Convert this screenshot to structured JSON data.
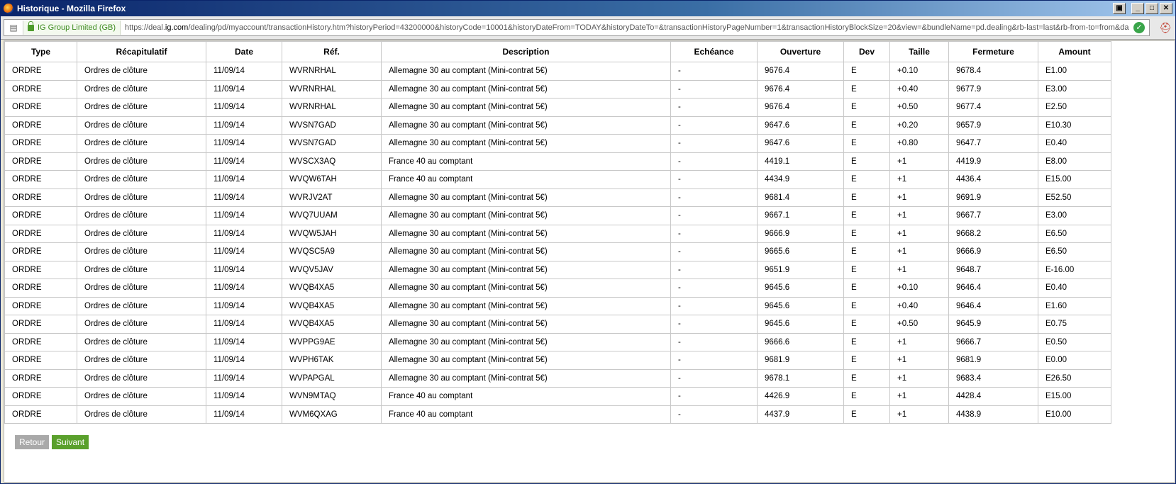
{
  "window": {
    "title": "Historique - Mozilla Firefox"
  },
  "navbar": {
    "identity": "IG Group Limited (GB)",
    "url_domain_prefix": "https://deal.",
    "url_domain_bold": "ig.com",
    "url_path": "/dealing/pd/myaccount/transactionHistory.htm?historyPeriod=43200000&historyCode=10001&historyDateFrom=TODAY&historyDateTo=&transactionHistoryPageNumber=1&transactionHistoryBlockSize=20&view=&bundleName=pd.dealing&rb-last=last&rb-from-to=from&da"
  },
  "table": {
    "headers": [
      "Type",
      "Récapitulatif",
      "Date",
      "Réf.",
      "Description",
      "Echéance",
      "Ouverture",
      "Dev",
      "Taille",
      "Fermeture",
      "Amount"
    ],
    "rows": [
      [
        "ORDRE",
        "Ordres de clôture",
        "11/09/14",
        "WVRNRHAL",
        "Allemagne 30 au comptant (Mini-contrat 5€)",
        "-",
        "9676.4",
        "E",
        "+0.10",
        "9678.4",
        "E1.00"
      ],
      [
        "ORDRE",
        "Ordres de clôture",
        "11/09/14",
        "WVRNRHAL",
        "Allemagne 30 au comptant (Mini-contrat 5€)",
        "-",
        "9676.4",
        "E",
        "+0.40",
        "9677.9",
        "E3.00"
      ],
      [
        "ORDRE",
        "Ordres de clôture",
        "11/09/14",
        "WVRNRHAL",
        "Allemagne 30 au comptant (Mini-contrat 5€)",
        "-",
        "9676.4",
        "E",
        "+0.50",
        "9677.4",
        "E2.50"
      ],
      [
        "ORDRE",
        "Ordres de clôture",
        "11/09/14",
        "WVSN7GAD",
        "Allemagne 30 au comptant (Mini-contrat 5€)",
        "-",
        "9647.6",
        "E",
        "+0.20",
        "9657.9",
        "E10.30"
      ],
      [
        "ORDRE",
        "Ordres de clôture",
        "11/09/14",
        "WVSN7GAD",
        "Allemagne 30 au comptant (Mini-contrat 5€)",
        "-",
        "9647.6",
        "E",
        "+0.80",
        "9647.7",
        "E0.40"
      ],
      [
        "ORDRE",
        "Ordres de clôture",
        "11/09/14",
        "WVSCX3AQ",
        "France 40 au comptant",
        "-",
        "4419.1",
        "E",
        "+1",
        "4419.9",
        "E8.00"
      ],
      [
        "ORDRE",
        "Ordres de clôture",
        "11/09/14",
        "WVQW6TAH",
        "France 40 au comptant",
        "-",
        "4434.9",
        "E",
        "+1",
        "4436.4",
        "E15.00"
      ],
      [
        "ORDRE",
        "Ordres de clôture",
        "11/09/14",
        "WVRJV2AT",
        "Allemagne 30 au comptant (Mini-contrat 5€)",
        "-",
        "9681.4",
        "E",
        "+1",
        "9691.9",
        "E52.50"
      ],
      [
        "ORDRE",
        "Ordres de clôture",
        "11/09/14",
        "WVQ7UUAM",
        "Allemagne 30 au comptant (Mini-contrat 5€)",
        "-",
        "9667.1",
        "E",
        "+1",
        "9667.7",
        "E3.00"
      ],
      [
        "ORDRE",
        "Ordres de clôture",
        "11/09/14",
        "WVQW5JAH",
        "Allemagne 30 au comptant (Mini-contrat 5€)",
        "-",
        "9666.9",
        "E",
        "+1",
        "9668.2",
        "E6.50"
      ],
      [
        "ORDRE",
        "Ordres de clôture",
        "11/09/14",
        "WVQSC5A9",
        "Allemagne 30 au comptant (Mini-contrat 5€)",
        "-",
        "9665.6",
        "E",
        "+1",
        "9666.9",
        "E6.50"
      ],
      [
        "ORDRE",
        "Ordres de clôture",
        "11/09/14",
        "WVQV5JAV",
        "Allemagne 30 au comptant (Mini-contrat 5€)",
        "-",
        "9651.9",
        "E",
        "+1",
        "9648.7",
        "E-16.00"
      ],
      [
        "ORDRE",
        "Ordres de clôture",
        "11/09/14",
        "WVQB4XA5",
        "Allemagne 30 au comptant (Mini-contrat 5€)",
        "-",
        "9645.6",
        "E",
        "+0.10",
        "9646.4",
        "E0.40"
      ],
      [
        "ORDRE",
        "Ordres de clôture",
        "11/09/14",
        "WVQB4XA5",
        "Allemagne 30 au comptant (Mini-contrat 5€)",
        "-",
        "9645.6",
        "E",
        "+0.40",
        "9646.4",
        "E1.60"
      ],
      [
        "ORDRE",
        "Ordres de clôture",
        "11/09/14",
        "WVQB4XA5",
        "Allemagne 30 au comptant (Mini-contrat 5€)",
        "-",
        "9645.6",
        "E",
        "+0.50",
        "9645.9",
        "E0.75"
      ],
      [
        "ORDRE",
        "Ordres de clôture",
        "11/09/14",
        "WVPPG9AE",
        "Allemagne 30 au comptant (Mini-contrat 5€)",
        "-",
        "9666.6",
        "E",
        "+1",
        "9666.7",
        "E0.50"
      ],
      [
        "ORDRE",
        "Ordres de clôture",
        "11/09/14",
        "WVPH6TAK",
        "Allemagne 30 au comptant (Mini-contrat 5€)",
        "-",
        "9681.9",
        "E",
        "+1",
        "9681.9",
        "E0.00"
      ],
      [
        "ORDRE",
        "Ordres de clôture",
        "11/09/14",
        "WVPAPGAL",
        "Allemagne 30 au comptant (Mini-contrat 5€)",
        "-",
        "9678.1",
        "E",
        "+1",
        "9683.4",
        "E26.50"
      ],
      [
        "ORDRE",
        "Ordres de clôture",
        "11/09/14",
        "WVN9MTAQ",
        "France 40 au comptant",
        "-",
        "4426.9",
        "E",
        "+1",
        "4428.4",
        "E15.00"
      ],
      [
        "ORDRE",
        "Ordres de clôture",
        "11/09/14",
        "WVM6QXAG",
        "France 40 au comptant",
        "-",
        "4437.9",
        "E",
        "+1",
        "4438.9",
        "E10.00"
      ]
    ]
  },
  "pagination": {
    "back_label": "Retour",
    "next_label": "Suivant"
  },
  "colors": {
    "next_button": "#5aa02c",
    "back_button": "#a9a9a9",
    "secure_identity": "#3b8a1d"
  }
}
